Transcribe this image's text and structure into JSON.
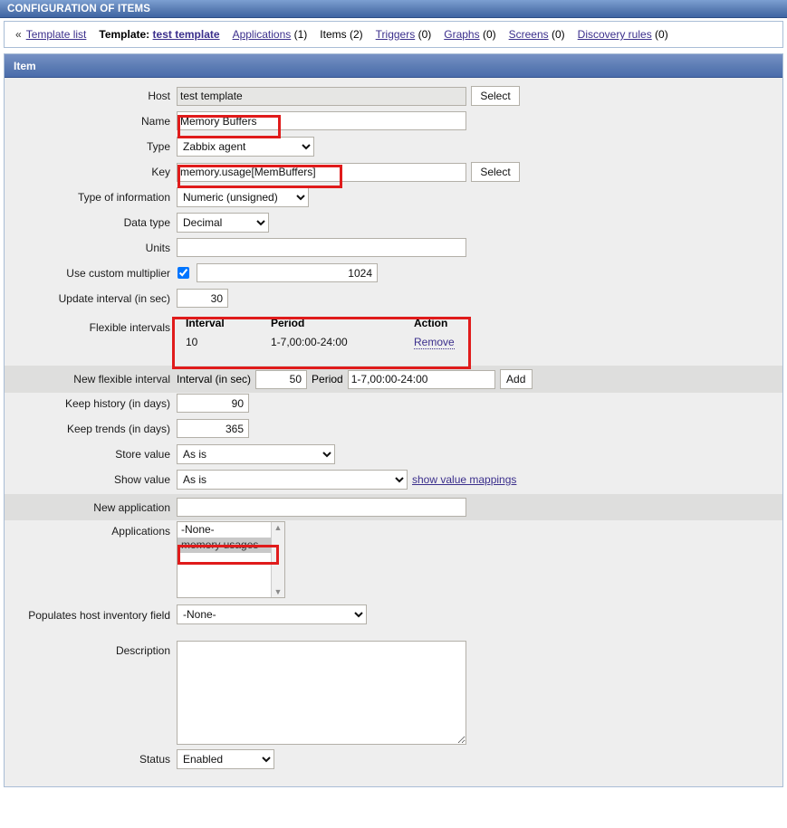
{
  "window": {
    "title": "CONFIGURATION OF ITEMS"
  },
  "nav": {
    "chevron": "«",
    "template_list": "Template list",
    "template_label": "Template:",
    "template_name": "test template",
    "items": [
      {
        "label": "Applications",
        "count": "(1)",
        "link": true
      },
      {
        "label": "Items",
        "count": "(2)",
        "link": false
      },
      {
        "label": "Triggers",
        "count": "(0)",
        "link": true
      },
      {
        "label": "Graphs",
        "count": "(0)",
        "link": true
      },
      {
        "label": "Screens",
        "count": "(0)",
        "link": true
      },
      {
        "label": "Discovery rules",
        "count": "(0)",
        "link": true
      }
    ]
  },
  "panel": {
    "header": "Item"
  },
  "form": {
    "host": {
      "label": "Host",
      "value": "test template",
      "select_button": "Select"
    },
    "name": {
      "label": "Name",
      "value": "Memory Buffers"
    },
    "type": {
      "label": "Type",
      "value": "Zabbix agent"
    },
    "key": {
      "label": "Key",
      "value": "memory.usage[MemBuffers]",
      "select_button": "Select"
    },
    "type_of_information": {
      "label": "Type of information",
      "value": "Numeric (unsigned)"
    },
    "data_type": {
      "label": "Data type",
      "value": "Decimal"
    },
    "units": {
      "label": "Units",
      "value": ""
    },
    "custom_multiplier": {
      "label": "Use custom multiplier",
      "checked": true,
      "value": "1024"
    },
    "update_interval": {
      "label": "Update interval (in sec)",
      "value": "30"
    },
    "flexible_intervals": {
      "label": "Flexible intervals",
      "columns": [
        "Interval",
        "Period",
        "Action"
      ],
      "rows": [
        {
          "interval": "10",
          "period": "1-7,00:00-24:00",
          "action": "Remove"
        }
      ]
    },
    "new_flexible_interval": {
      "label": "New flexible interval",
      "interval_label": "Interval (in sec)",
      "interval_value": "50",
      "period_label": "Period",
      "period_value": "1-7,00:00-24:00",
      "add_button": "Add"
    },
    "keep_history": {
      "label": "Keep history (in days)",
      "value": "90"
    },
    "keep_trends": {
      "label": "Keep trends (in days)",
      "value": "365"
    },
    "store_value": {
      "label": "Store value",
      "value": "As is"
    },
    "show_value": {
      "label": "Show value",
      "value": "As is",
      "mappings_link": "show value mappings"
    },
    "new_application": {
      "label": "New application",
      "value": ""
    },
    "applications": {
      "label": "Applications",
      "options": [
        "-None-",
        "memory usages"
      ],
      "selected": "memory usages"
    },
    "host_inventory": {
      "label": "Populates host inventory field",
      "value": "-None-"
    },
    "description": {
      "label": "Description",
      "value": ""
    },
    "status": {
      "label": "Status",
      "value": "Enabled"
    }
  },
  "annotations": {
    "color": "#e01b1b",
    "boxes": [
      "name-field",
      "key-field",
      "flexible-intervals-table",
      "applications-selected-option"
    ]
  }
}
